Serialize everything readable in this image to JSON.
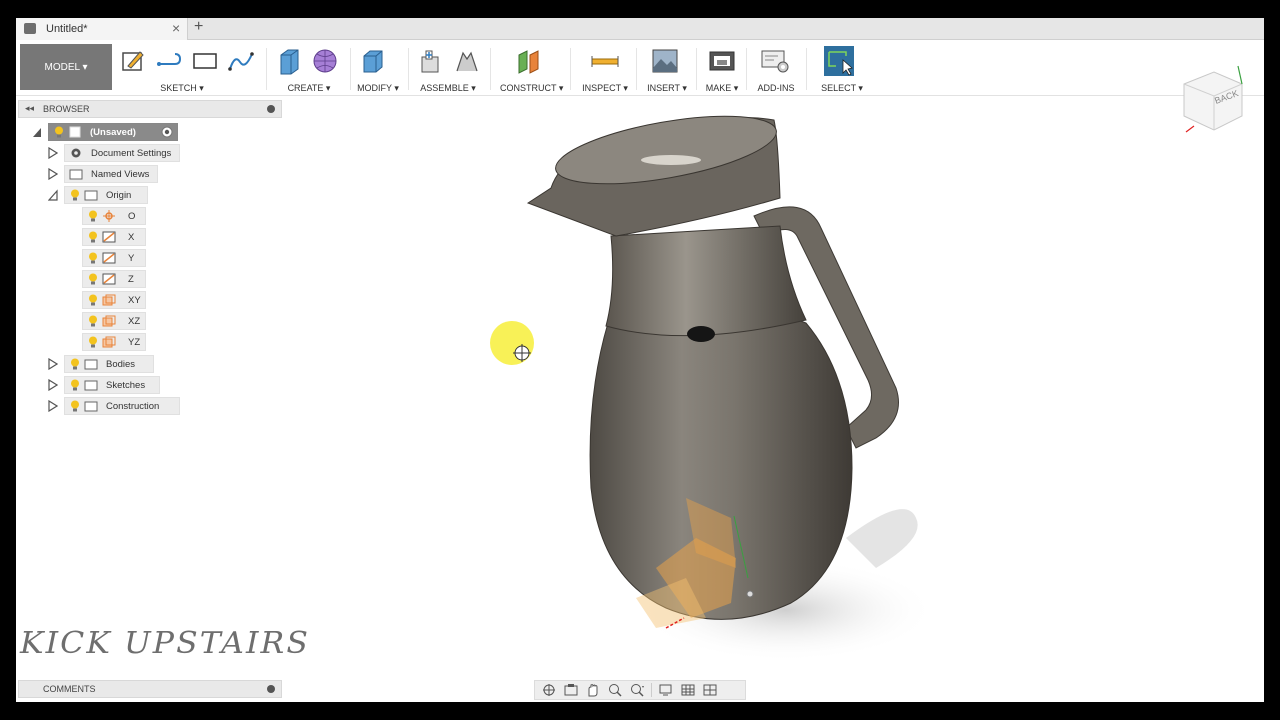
{
  "window": {
    "tab_title": "Untitled*",
    "new_tab": "+",
    "close": "×"
  },
  "toolbar": {
    "workspace": "MODEL ▾",
    "groups": {
      "sketch": "SKETCH ▾",
      "create": "CREATE ▾",
      "modify": "MODIFY ▾",
      "assemble": "ASSEMBLE ▾",
      "construct": "CONSTRUCT ▾",
      "inspect": "INSPECT ▾",
      "insert": "INSERT ▾",
      "make": "MAKE ▾",
      "addins": "ADD-INS",
      "select": "SELECT ▾"
    }
  },
  "browser": {
    "title": "BROWSER",
    "root": "(Unsaved)",
    "items": {
      "document_settings": "Document Settings",
      "named_views": "Named Views",
      "origin": "Origin",
      "o": "O",
      "x": "X",
      "y": "Y",
      "z": "Z",
      "xy": "XY",
      "xz": "XZ",
      "yz": "YZ",
      "bodies": "Bodies",
      "sketches": "Sketches",
      "construction": "Construction"
    }
  },
  "viewcube": {
    "face": "BACK"
  },
  "watermark": "KICK UPSTAIRS",
  "comments": {
    "title": "COMMENTS"
  },
  "colors": {
    "accent": "#2e7bbf",
    "bulb": "#f3c31e",
    "origin_plane": "#e8833a",
    "body": "#6b665f"
  }
}
